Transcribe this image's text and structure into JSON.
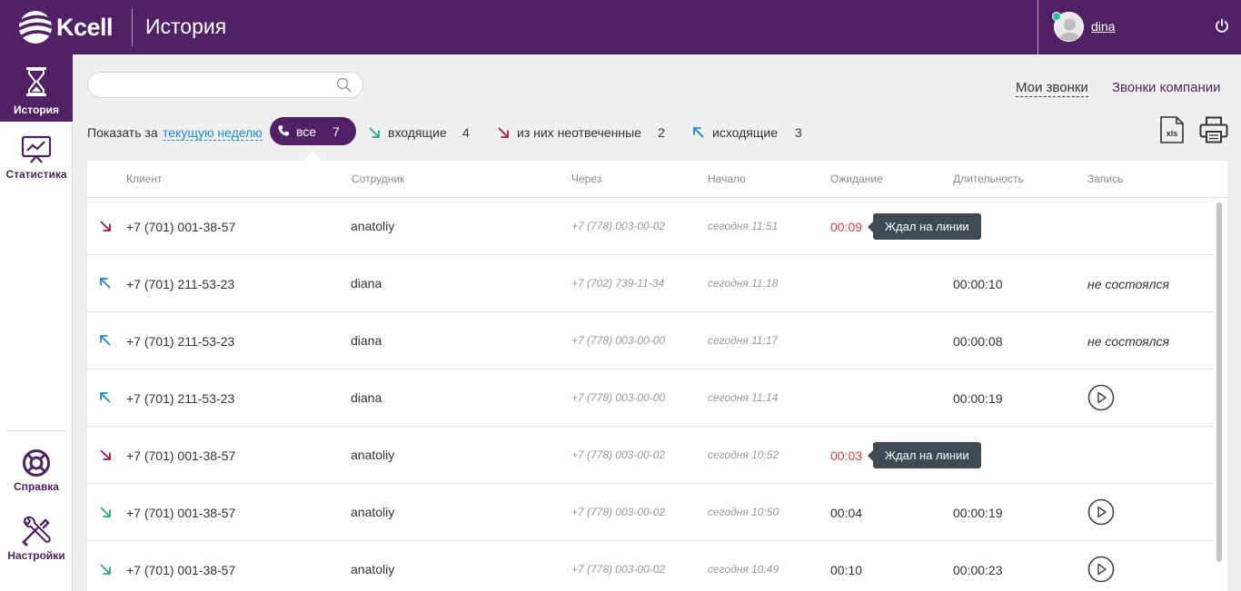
{
  "header": {
    "logo_text": "Kcell",
    "title": "История",
    "user_name": "dina"
  },
  "sidebar": {
    "items": [
      {
        "label": "История",
        "icon": "hourglass-icon"
      },
      {
        "label": "Статистика",
        "icon": "chart-board-icon"
      },
      {
        "label": "Справка",
        "icon": "lifebuoy-icon"
      },
      {
        "label": "Настройки",
        "icon": "tools-icon"
      }
    ]
  },
  "search": {
    "value": "",
    "placeholder": ""
  },
  "views": {
    "my_calls": "Мои звонки",
    "company_calls": "Звонки компании"
  },
  "filters": {
    "show_label": "Показать за",
    "period": "текущую неделю",
    "all": {
      "label": "все",
      "count": "7"
    },
    "incoming": {
      "label": "входящие",
      "count": "4"
    },
    "missed": {
      "label": "из них неотвеченные",
      "count": "2"
    },
    "outgoing": {
      "label": "исходящие",
      "count": "3"
    }
  },
  "table": {
    "columns": [
      "Клиент",
      "Сотрудник",
      "Через",
      "Начало",
      "Ожидание",
      "Длительность",
      "Запись"
    ],
    "rows": [
      {
        "dir": "missed",
        "client": "+7 (701) 001-38-57",
        "employee": "anatoliy",
        "via": "+7 (778) 003-00-02",
        "start": "сегодня 11:51",
        "wait": "00:09",
        "duration": "",
        "record": "",
        "tooltip": "Ждал на линии"
      },
      {
        "dir": "outgoing",
        "client": "+7 (701) 211-53-23",
        "employee": "diana",
        "via": "+7 (702) 739-11-34",
        "start": "сегодня 11:18",
        "wait": "",
        "duration": "00:00:10",
        "record": "не состоялся"
      },
      {
        "dir": "outgoing",
        "client": "+7 (701) 211-53-23",
        "employee": "diana",
        "via": "+7 (778) 003-00-00",
        "start": "сегодня 11:17",
        "wait": "",
        "duration": "00:00:08",
        "record": "не состоялся"
      },
      {
        "dir": "outgoing",
        "client": "+7 (701) 211-53-23",
        "employee": "diana",
        "via": "+7 (778) 003-00-00",
        "start": "сегодня 11:14",
        "wait": "",
        "duration": "00:00:19",
        "record": "play"
      },
      {
        "dir": "missed",
        "client": "+7 (701) 001-38-57",
        "employee": "anatoliy",
        "via": "+7 (778) 003-00-02",
        "start": "сегодня 10:52",
        "wait": "00:03",
        "duration": "",
        "record": "",
        "tooltip": "Ждал на линии"
      },
      {
        "dir": "incoming",
        "client": "+7 (701) 001-38-57",
        "employee": "anatoliy",
        "via": "+7 (778) 003-00-02",
        "start": "сегодня 10:50",
        "wait": "00:04",
        "duration": "00:00:19",
        "record": "play"
      },
      {
        "dir": "incoming",
        "client": "+7 (701) 001-38-57",
        "employee": "anatoliy",
        "via": "+7 (778) 003-00-02",
        "start": "сегодня 10:49",
        "wait": "00:10",
        "duration": "00:00:23",
        "record": "play"
      }
    ]
  },
  "colors": {
    "brand": "#502265",
    "incoming": "#1faa8c",
    "missed": "#a3174f",
    "outgoing": "#1d8ac9",
    "wait_missed": "#e63b3b"
  }
}
